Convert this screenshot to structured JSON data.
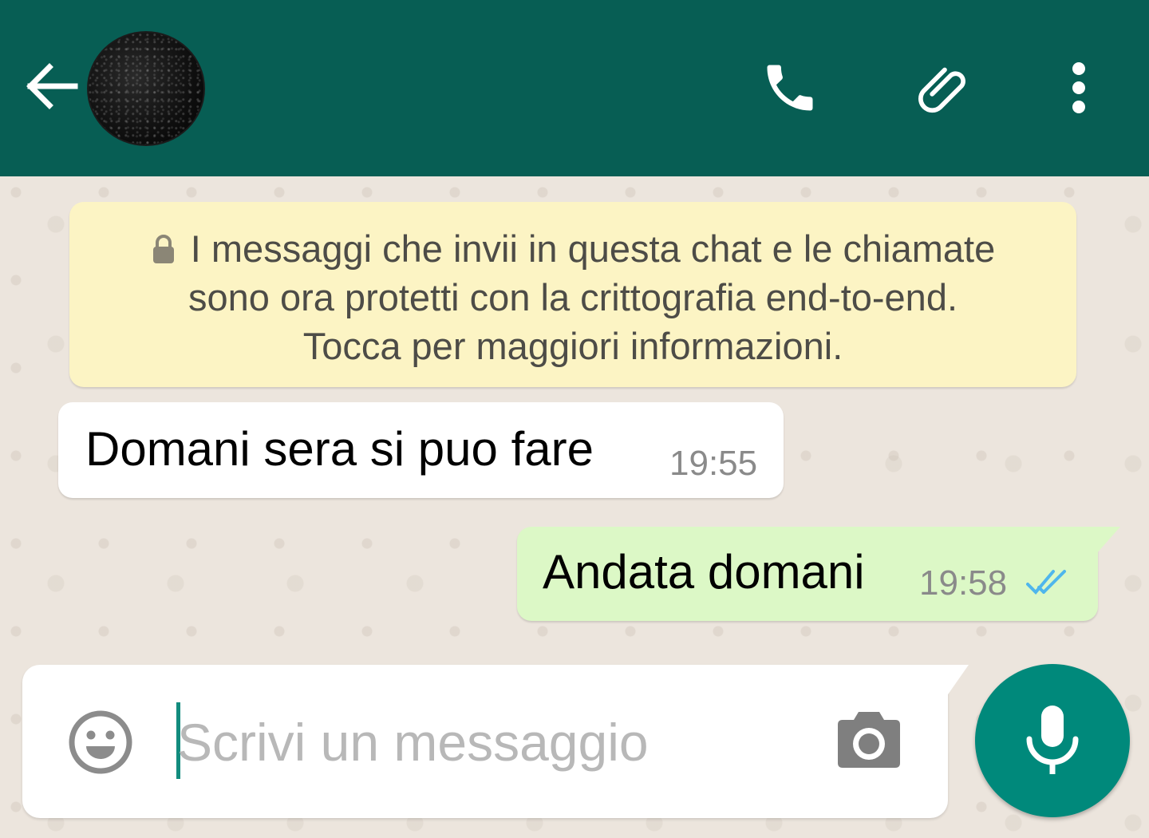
{
  "header": {
    "back_icon": "arrow-left-icon",
    "avatar_icon": "contact-avatar",
    "actions": [
      {
        "name": "call",
        "icon": "phone-icon"
      },
      {
        "name": "attach",
        "icon": "paperclip-icon"
      },
      {
        "name": "more",
        "icon": "more-vert-icon"
      }
    ],
    "color": "#075e54"
  },
  "notice": {
    "icon": "lock-icon",
    "lines": [
      "I messaggi che invii in questa chat e le chiamate",
      "sono ora protetti con la crittografia end-to-end.",
      "Tocca per maggiori informazioni."
    ],
    "background": "#fcf4c4"
  },
  "messages": [
    {
      "direction": "incoming",
      "text": "Domani sera si puo fare",
      "time": "19:55"
    },
    {
      "direction": "outgoing",
      "text": "Andata domani",
      "time": "19:58",
      "status": "read",
      "status_icon": "double-check-icon"
    }
  ],
  "composer": {
    "emoji_icon": "emoji-icon",
    "placeholder": "Scrivi un messaggio",
    "value": "",
    "camera_icon": "camera-icon",
    "mic_icon": "microphone-icon",
    "accent": "#00897b"
  }
}
